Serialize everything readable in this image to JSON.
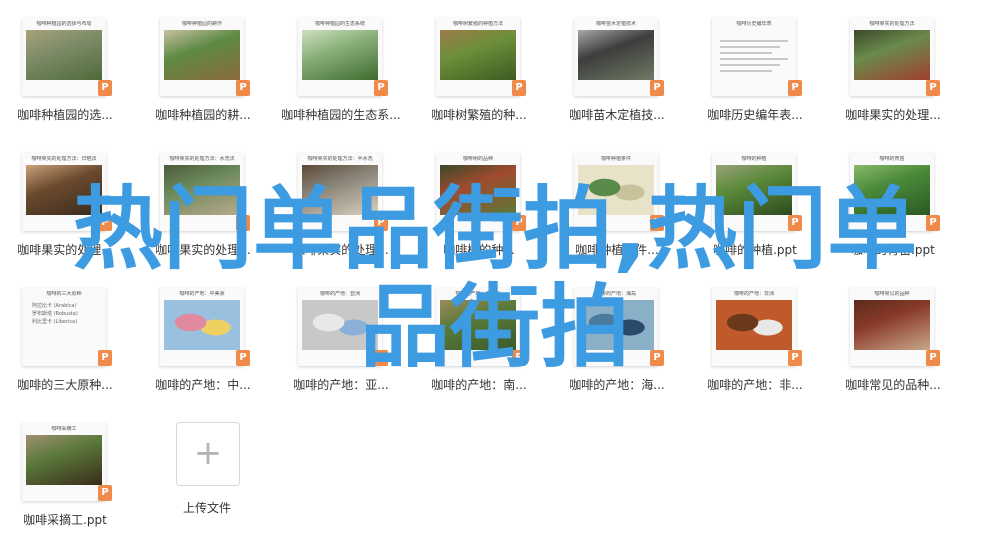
{
  "files": [
    {
      "name": "咖啡种植园的选...",
      "thumb_title": "咖啡种植园的选择与布局",
      "style": "photo",
      "colors": [
        "#7d8c68",
        "#4f6a3a",
        "#a9a27a"
      ]
    },
    {
      "name": "咖啡种植园的耕...",
      "thumb_title": "咖啡种植园的耕作",
      "style": "photo",
      "colors": [
        "#5e8a44",
        "#8a6a3c",
        "#c7c0a0"
      ]
    },
    {
      "name": "咖啡种植园的生态系...",
      "thumb_title": "咖啡种植园的生态系统",
      "style": "photo",
      "colors": [
        "#8ab07a",
        "#3f6b2e",
        "#cfe0c0"
      ]
    },
    {
      "name": "咖啡树繁殖的种...",
      "thumb_title": "咖啡树繁殖的种植方法",
      "style": "photo",
      "colors": [
        "#6d8f3a",
        "#3e5a22",
        "#9d7a4a"
      ]
    },
    {
      "name": "咖啡苗木定植技...",
      "thumb_title": "咖啡苗木定植技术",
      "style": "photo",
      "colors": [
        "#3d3d3d",
        "#6f7a63",
        "#a8a8a8"
      ]
    },
    {
      "name": "咖啡历史编年表...",
      "thumb_title": "咖啡历史编年表",
      "style": "text",
      "colors": [
        "#c8c8c8",
        "#c8c8c8",
        "#c8c8c8"
      ]
    },
    {
      "name": "咖啡果实的处理...",
      "thumb_title": "咖啡果实的处理方法",
      "style": "photo",
      "colors": [
        "#6a8a4a",
        "#a04030",
        "#3b4a2c"
      ]
    },
    {
      "name": "咖啡果实的处理...",
      "thumb_title": "咖啡果实的处理方法：日晒法",
      "style": "photo",
      "colors": [
        "#6b4a2e",
        "#3a2a1c",
        "#caa27a"
      ]
    },
    {
      "name": "咖啡果实的处理...",
      "thumb_title": "咖啡果实的处理方法：水洗法",
      "style": "photo",
      "colors": [
        "#6c8a5c",
        "#b9a98a",
        "#4a5a3a"
      ]
    },
    {
      "name": "咖啡果实的处理...",
      "thumb_title": "咖啡果实的处理方法：半水洗",
      "style": "photo",
      "colors": [
        "#8a8478",
        "#d8d0c0",
        "#5a4a3a"
      ]
    },
    {
      "name": "咖啡树的种...",
      "thumb_title": "咖啡树的品种",
      "style": "photo",
      "colors": [
        "#a04a2e",
        "#5a7a3a",
        "#3a4a2a"
      ]
    },
    {
      "name": "咖啡种植条件...",
      "thumb_title": "咖啡种植条件",
      "style": "map",
      "colors": [
        "#c8c29a",
        "#5a8a4a",
        "#e8e2c8"
      ]
    },
    {
      "name": "咖啡的种植.ppt",
      "thumb_title": "咖啡的种植",
      "style": "photo",
      "colors": [
        "#5a8a3a",
        "#2e4a1e",
        "#9aa07a"
      ]
    },
    {
      "name": "咖啡的育苗.ppt",
      "thumb_title": "咖啡的育苗",
      "style": "photo",
      "colors": [
        "#4a8a3a",
        "#2a5a22",
        "#8ab86a"
      ]
    },
    {
      "name": "咖啡的三大原种...",
      "thumb_title": "咖啡的三大原种",
      "style": "bullets",
      "bullets": [
        "阿拉比卡 (Arabica)",
        "罗布斯塔 (Robusta)",
        "利比里卡 (Liberica)"
      ],
      "colors": [
        "#c8c8c8",
        "#c8c8c8",
        "#c8c8c8"
      ]
    },
    {
      "name": "咖啡的产地：中...",
      "thumb_title": "咖啡的产地：中美洲",
      "style": "map",
      "colors": [
        "#f0d060",
        "#e08aa0",
        "#9ac0e0"
      ]
    },
    {
      "name": "咖啡的产地：亚...",
      "thumb_title": "咖啡的产地：亚洲",
      "style": "map",
      "colors": [
        "#8ab0d8",
        "#e8e8e8",
        "#c8c8c8"
      ]
    },
    {
      "name": "咖啡的产地：南...",
      "thumb_title": "咖啡的产地：南美洲",
      "style": "photo",
      "colors": [
        "#5a7a3a",
        "#3a5a2a",
        "#9a8a5a"
      ]
    },
    {
      "name": "咖啡的产地：海...",
      "thumb_title": "咖啡的产地：海岛",
      "style": "map",
      "colors": [
        "#2a4a6a",
        "#4a7aa0",
        "#8ab0c8"
      ]
    },
    {
      "name": "咖啡的产地：非...",
      "thumb_title": "咖啡的产地：非洲",
      "style": "map",
      "colors": [
        "#e8e8e8",
        "#6a3a1a",
        "#c05a2a"
      ]
    },
    {
      "name": "咖啡常见的品种...",
      "thumb_title": "咖啡常见的品种",
      "style": "photo",
      "colors": [
        "#8a3a2a",
        "#c8a88a",
        "#5a2a1a"
      ]
    },
    {
      "name": "咖啡采摘工.ppt",
      "thumb_title": "咖啡采摘工",
      "style": "photo",
      "colors": [
        "#5a7a3a",
        "#3a2a1a",
        "#a09070"
      ]
    }
  ],
  "file_badge": "P",
  "upload": {
    "icon": "plus-icon",
    "label": "上传文件"
  },
  "watermark": {
    "line1": "热门单品街拍,热门单",
    "line2": "品街拍"
  }
}
